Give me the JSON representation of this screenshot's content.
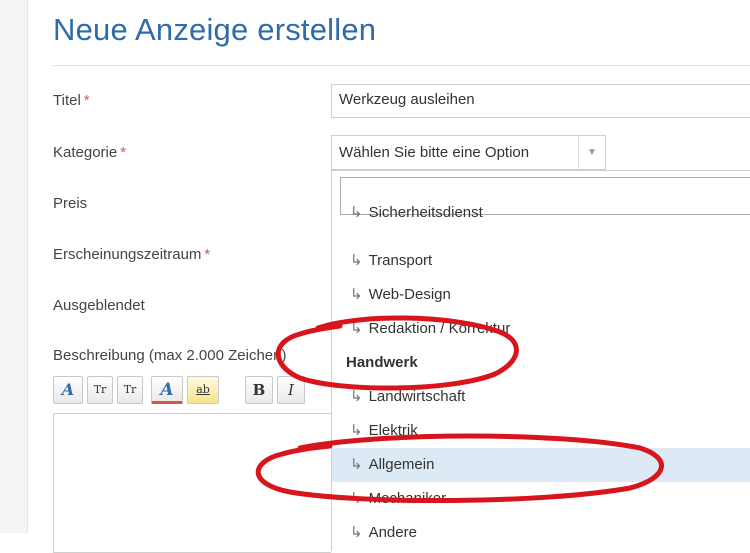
{
  "page": {
    "title": "Neue Anzeige erstellen"
  },
  "form": {
    "required_marker": "*",
    "labels": {
      "title": "Titel",
      "category": "Kategorie",
      "price": "Preis",
      "period": "Erscheinungszeitraum",
      "hidden": "Ausgeblendet",
      "description": "Beschreibung (max 2.000 Zeichen)"
    },
    "title_value": "Werkzeug ausleihen",
    "category_value": "Wählen Sie bitte eine Option"
  },
  "dropdown": {
    "search_value": "",
    "items": [
      {
        "label": "Sicherheitsdienst",
        "type": "option"
      },
      {
        "label": "Transport",
        "type": "option"
      },
      {
        "label": "Web-Design",
        "type": "option"
      },
      {
        "label": "Redaktion / Korrektur",
        "type": "option"
      },
      {
        "label": "Handwerk",
        "type": "group"
      },
      {
        "label": "Landwirtschaft",
        "type": "option"
      },
      {
        "label": "Elektrik",
        "type": "option"
      },
      {
        "label": "Allgemein",
        "type": "option",
        "highlighted": true
      },
      {
        "label": "Mechaniker",
        "type": "option"
      },
      {
        "label": "Andere",
        "type": "option"
      }
    ],
    "option_prefix": "↳"
  },
  "editor_toolbar": {
    "buttons": [
      {
        "name": "text-style",
        "glyph": "A"
      },
      {
        "name": "superscript",
        "glyph": "Tr"
      },
      {
        "name": "subscript",
        "glyph": "Tr"
      },
      {
        "name": "font-color",
        "glyph": "A"
      },
      {
        "name": "highlight",
        "glyph": "ab"
      },
      {
        "name": "bold",
        "glyph": "B"
      },
      {
        "name": "italic",
        "glyph": "I"
      }
    ]
  },
  "colors": {
    "title_blue": "#2d6ca8",
    "required_red": "#d9534f",
    "highlight_bg": "#ddeaf6",
    "annotation_red": "#d8141c"
  }
}
